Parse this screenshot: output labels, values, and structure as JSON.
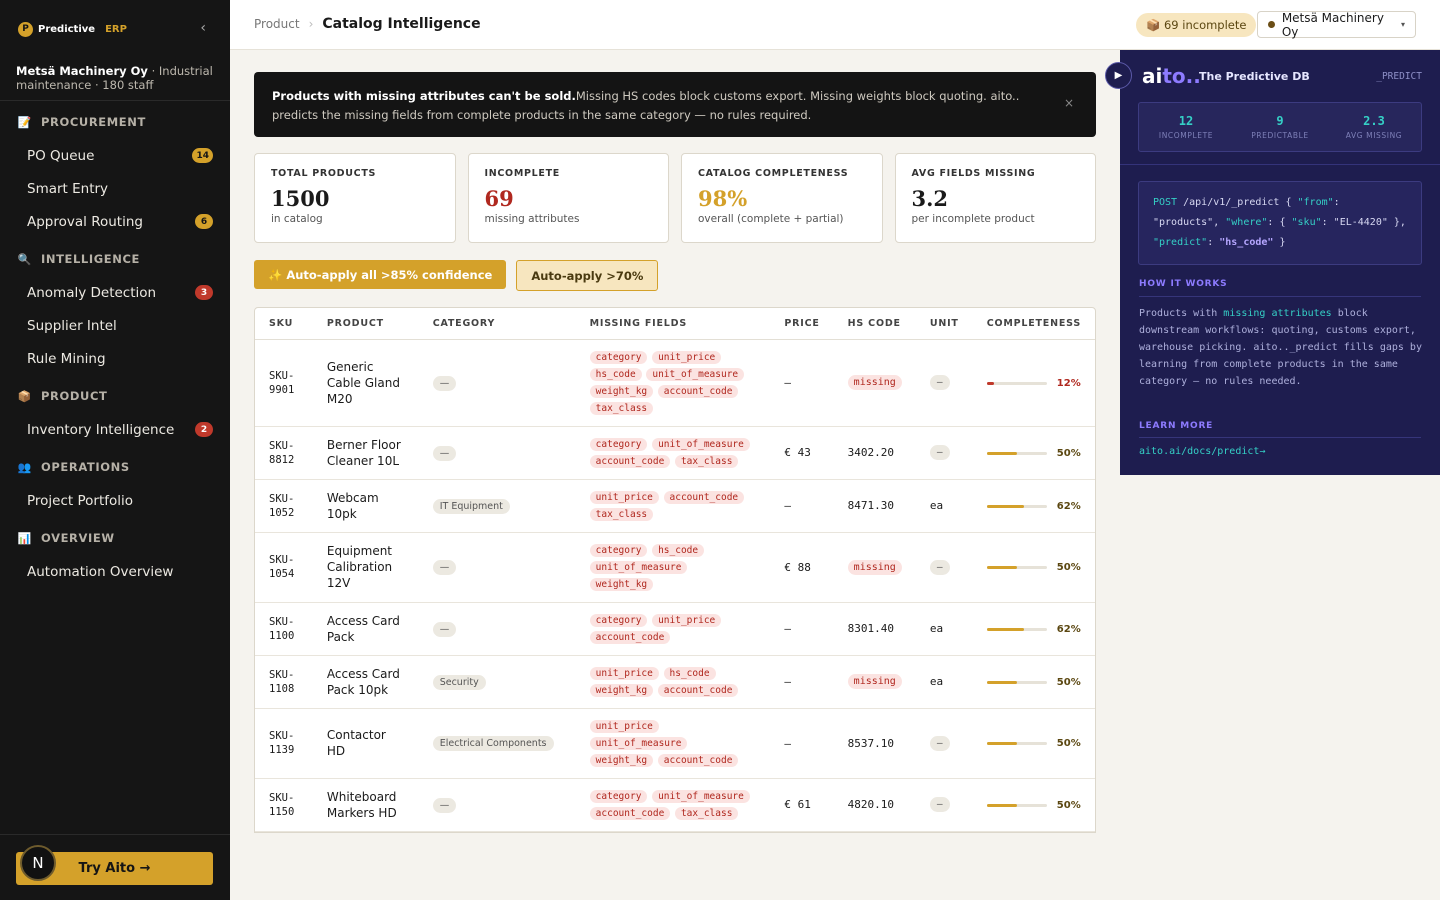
{
  "sidebar": {
    "brand_logo": "P",
    "brand_name": "Predictive",
    "brand_erp": "ERP",
    "collapse_glyph": "‹",
    "org_name": "Metsä Machinery Oy",
    "org_desc": " · Industrial maintenance · 180 staff",
    "sections": [
      {
        "label": "PROCUREMENT",
        "icon": "clipboard-icon",
        "items": [
          {
            "label": "PO Queue",
            "badge": "14",
            "badge_color": "gold"
          },
          {
            "label": "Smart Entry",
            "badge": ""
          },
          {
            "label": "Approval Routing",
            "badge": "6",
            "badge_color": "gold"
          }
        ]
      },
      {
        "label": "INTELLIGENCE",
        "icon": "magnifier-icon",
        "items": [
          {
            "label": "Anomaly Detection",
            "badge": "3",
            "badge_color": "red"
          },
          {
            "label": "Supplier Intel",
            "badge": ""
          },
          {
            "label": "Rule Mining",
            "badge": ""
          }
        ]
      },
      {
        "label": "PRODUCT",
        "icon": "package-icon",
        "items": [
          {
            "label": "Inventory Intelligence",
            "badge": "2",
            "badge_color": "red"
          }
        ]
      },
      {
        "label": "OPERATIONS",
        "icon": "people-icon",
        "items": [
          {
            "label": "Project Portfolio",
            "badge": ""
          }
        ]
      },
      {
        "label": "OVERVIEW",
        "icon": "bar-chart-icon",
        "items": [
          {
            "label": "Automation Overview",
            "badge": ""
          }
        ]
      }
    ],
    "avatar_letter": "N",
    "try_button": "Try Aito →"
  },
  "header": {
    "breadcrumb_parent": "Product",
    "breadcrumb_sep": "›",
    "breadcrumb_current": "Catalog Intelligence",
    "incomplete_pill": "📦 69 incomplete",
    "org_select": "Metsä Machinery Oy",
    "org_caret": "▾"
  },
  "banner": {
    "bold": "Products with missing attributes can't be sold.",
    "text": "Missing HS codes block customs export. Missing weights block quoting. aito.. predicts the missing fields from complete products in the same category — no rules required.",
    "close": "×"
  },
  "stats": [
    {
      "label": "TOTAL PRODUCTS",
      "value": "1500",
      "sub": "in catalog",
      "color": "#1a1a1a"
    },
    {
      "label": "INCOMPLETE",
      "value": "69",
      "sub": "missing attributes",
      "color": "#b0281f"
    },
    {
      "label": "CATALOG COMPLETENESS",
      "value": "98%",
      "sub": "overall (complete + partial)",
      "color": "#d4a12a"
    },
    {
      "label": "AVG FIELDS MISSING",
      "value": "3.2",
      "sub": "per incomplete product",
      "color": "#1a1a1a"
    }
  ],
  "actions": {
    "primary": "✨ Auto-apply all >85% confidence",
    "secondary": "Auto-apply >70%"
  },
  "table": {
    "columns": [
      "SKU",
      "PRODUCT",
      "CATEGORY",
      "MISSING FIELDS",
      "PRICE",
      "HS CODE",
      "UNIT",
      "COMPLETENESS"
    ],
    "rows": [
      {
        "sku": "SKU-9901",
        "product": "Generic Cable Gland M20",
        "category": "—",
        "missing": [
          "category",
          "unit_price",
          "hs_code",
          "unit_of_measure",
          "weight_kg",
          "account_code",
          "tax_class"
        ],
        "price": "—",
        "hs": "missing",
        "unit": "—",
        "pct": "12%",
        "fill": 0.12,
        "bar_color": "#c0392b",
        "pct_color": "#b0281f"
      },
      {
        "sku": "SKU-8812",
        "product": "Berner Floor Cleaner 10L",
        "category": "—",
        "missing": [
          "category",
          "unit_of_measure",
          "account_code",
          "tax_class"
        ],
        "price": "€ 43",
        "hs": "3402.20",
        "unit": "—",
        "pct": "50%",
        "fill": 0.5,
        "bar_color": "#d4a12a",
        "pct_color": "#5b4711"
      },
      {
        "sku": "SKU-1052",
        "product": "Webcam 10pk",
        "category": "IT Equipment",
        "missing": [
          "unit_price",
          "account_code",
          "tax_class"
        ],
        "price": "—",
        "hs": "8471.30",
        "unit": "ea",
        "pct": "62%",
        "fill": 0.62,
        "bar_color": "#d4a12a",
        "pct_color": "#5b4711"
      },
      {
        "sku": "SKU-1054",
        "product": "Equipment Calibration 12V",
        "category": "—",
        "missing": [
          "category",
          "hs_code",
          "unit_of_measure",
          "weight_kg"
        ],
        "price": "€ 88",
        "hs": "missing",
        "unit": "—",
        "pct": "50%",
        "fill": 0.5,
        "bar_color": "#d4a12a",
        "pct_color": "#5b4711"
      },
      {
        "sku": "SKU-1100",
        "product": "Access Card Pack",
        "category": "—",
        "missing": [
          "category",
          "unit_price",
          "account_code"
        ],
        "price": "—",
        "hs": "8301.40",
        "unit": "ea",
        "pct": "62%",
        "fill": 0.62,
        "bar_color": "#d4a12a",
        "pct_color": "#5b4711"
      },
      {
        "sku": "SKU-1108",
        "product": "Access Card Pack 10pk",
        "category": "Security",
        "missing": [
          "unit_price",
          "hs_code",
          "weight_kg",
          "account_code"
        ],
        "price": "—",
        "hs": "missing",
        "unit": "ea",
        "pct": "50%",
        "fill": 0.5,
        "bar_color": "#d4a12a",
        "pct_color": "#5b4711"
      },
      {
        "sku": "SKU-1139",
        "product": "Contactor HD",
        "category": "Electrical Components",
        "missing": [
          "unit_price",
          "unit_of_measure",
          "weight_kg",
          "account_code"
        ],
        "price": "—",
        "hs": "8537.10",
        "unit": "—",
        "pct": "50%",
        "fill": 0.5,
        "bar_color": "#d4a12a",
        "pct_color": "#5b4711"
      },
      {
        "sku": "SKU-1150",
        "product": "Whiteboard Markers HD",
        "category": "—",
        "missing": [
          "category",
          "unit_of_measure",
          "account_code",
          "tax_class"
        ],
        "price": "€ 61",
        "hs": "4820.10",
        "unit": "—",
        "pct": "50%",
        "fill": 0.5,
        "bar_color": "#d4a12a",
        "pct_color": "#5b4711"
      }
    ]
  },
  "aito": {
    "toggle_glyph": "▶",
    "logo_main": "ai",
    "logo_accent": "to..",
    "tagline": "The Predictive DB",
    "endpoint_tag": "_PREDICT",
    "stats": [
      {
        "value": "12",
        "label": "INCOMPLETE"
      },
      {
        "value": "9",
        "label": "PREDICTABLE"
      },
      {
        "value": "2.3",
        "label": "AVG MISSING"
      }
    ],
    "code": {
      "method": "POST",
      "path": " /api/v1/_predict { ",
      "k_from": "\"from\"",
      "p1": ":",
      "v_from": "\"products\"",
      "p2": ", ",
      "k_where": "\"where\"",
      "p3": ": { ",
      "k_sku": "\"sku\"",
      "p4": ": ",
      "v_sku": "\"EL-4420\"",
      "p5": "}, ",
      "k_predict": "\"predict\"",
      "p6": ": ",
      "v_predict": "\"hs_code\"",
      "p7": " }"
    },
    "how_title": "HOW IT WORKS",
    "how_pre": "Products with ",
    "how_hl": "missing attributes",
    "how_post": " block downstream workflows: quoting, customs export, warehouse picking. aito.._predict fills gaps by learning from complete products in the same category — no rules needed.",
    "learn_title": "LEARN MORE",
    "learn_link": "aito.ai/docs/predict→"
  }
}
